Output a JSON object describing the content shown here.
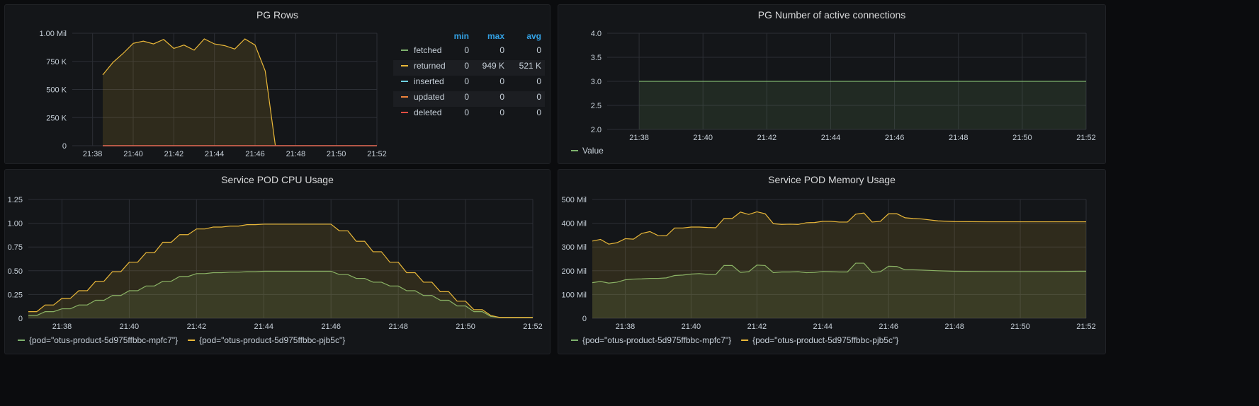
{
  "panels": [
    {
      "id": "pg-rows",
      "title": "PG Rows",
      "legend": {
        "headers": [
          "min",
          "max",
          "avg"
        ],
        "rows": [
          {
            "name": "fetched",
            "color": "#7eb26d",
            "min": "0",
            "max": "0",
            "avg": "0"
          },
          {
            "name": "returned",
            "color": "#eab839",
            "min": "0",
            "max": "949 K",
            "avg": "521 K"
          },
          {
            "name": "inserted",
            "color": "#6ed0e0",
            "min": "0",
            "max": "0",
            "avg": "0"
          },
          {
            "name": "updated",
            "color": "#ef843c",
            "min": "0",
            "max": "0",
            "avg": "0"
          },
          {
            "name": "deleted",
            "color": "#e24d42",
            "min": "0",
            "max": "0",
            "avg": "0"
          }
        ]
      }
    },
    {
      "id": "pg-connections",
      "title": "PG Number of active connections",
      "legend_items": [
        {
          "name": "Value",
          "color": "#7eb26d"
        }
      ]
    },
    {
      "id": "pod-cpu",
      "title": "Service POD CPU Usage",
      "legend_items": [
        {
          "name": "{pod=\"otus-product-5d975ffbbc-mpfc7\"}",
          "color": "#7eb26d"
        },
        {
          "name": "{pod=\"otus-product-5d975ffbbc-pjb5c\"}",
          "color": "#eab839"
        }
      ]
    },
    {
      "id": "pod-memory",
      "title": "Service POD Memory Usage",
      "legend_items": [
        {
          "name": "{pod=\"otus-product-5d975ffbbc-mpfc7\"}",
          "color": "#7eb26d"
        },
        {
          "name": "{pod=\"otus-product-5d975ffbbc-pjb5c\"}",
          "color": "#eab839"
        }
      ]
    }
  ],
  "chart_data": [
    {
      "type": "area",
      "title": "PG Rows",
      "x_range": [
        "21:37",
        "21:52"
      ],
      "x_ticks": [
        "21:38",
        "21:40",
        "21:42",
        "21:44",
        "21:46",
        "21:48",
        "21:50",
        "21:52"
      ],
      "y_ticks": [
        "0",
        "250 K",
        "500 K",
        "750 K",
        "1.00 Mil"
      ],
      "ylim": [
        0,
        1000000
      ],
      "series": [
        {
          "name": "returned",
          "color": "#eab839",
          "x": [
            "21:38:30",
            "21:39:00",
            "21:39:30",
            "21:40:00",
            "21:40:30",
            "21:41:00",
            "21:41:30",
            "21:42:00",
            "21:42:30",
            "21:43:00",
            "21:43:30",
            "21:44:00",
            "21:44:30",
            "21:45:00",
            "21:45:30",
            "21:46:00",
            "21:46:30",
            "21:47:00"
          ],
          "values": [
            630000,
            740000,
            820000,
            910000,
            930000,
            905000,
            945000,
            865000,
            895000,
            850000,
            950000,
            905000,
            890000,
            860000,
            950000,
            895000,
            665000,
            0
          ]
        },
        {
          "name": "fetched",
          "color": "#7eb26d",
          "x": [
            "21:38:30",
            "21:52:00"
          ],
          "values": [
            0,
            0
          ]
        },
        {
          "name": "inserted",
          "color": "#6ed0e0",
          "x": [
            "21:38:30",
            "21:52:00"
          ],
          "values": [
            0,
            0
          ]
        },
        {
          "name": "updated",
          "color": "#ef843c",
          "x": [
            "21:38:30",
            "21:52:00"
          ],
          "values": [
            0,
            0
          ]
        },
        {
          "name": "deleted",
          "color": "#e24d42",
          "x": [
            "21:38:30",
            "21:52:00"
          ],
          "values": [
            0,
            0
          ]
        }
      ]
    },
    {
      "type": "area",
      "title": "PG Number of active connections",
      "x_range": [
        "21:37",
        "21:52"
      ],
      "x_ticks": [
        "21:38",
        "21:40",
        "21:42",
        "21:44",
        "21:46",
        "21:48",
        "21:50",
        "21:52"
      ],
      "y_ticks": [
        "2.0",
        "2.5",
        "3.0",
        "3.5",
        "4.0"
      ],
      "ylim": [
        2,
        4
      ],
      "series": [
        {
          "name": "Value",
          "color": "#7eb26d",
          "x": [
            "21:38:00",
            "21:52:00"
          ],
          "values": [
            3,
            3
          ]
        }
      ]
    },
    {
      "type": "area",
      "title": "Service POD CPU Usage",
      "x_range": [
        "21:37",
        "21:52"
      ],
      "x_ticks": [
        "21:38",
        "21:40",
        "21:42",
        "21:44",
        "21:46",
        "21:48",
        "21:50",
        "21:52"
      ],
      "y_ticks": [
        "0",
        "0.25",
        "0.50",
        "0.75",
        "1.00",
        "1.25"
      ],
      "ylim": [
        0,
        1.25
      ],
      "series": [
        {
          "name": "{pod=\"otus-product-5d975ffbbc-mpfc7\"}",
          "color": "#7eb26d",
          "x": [
            "21:37:00",
            "21:37:15",
            "21:37:30",
            "21:37:45",
            "21:38:00",
            "21:38:15",
            "21:38:30",
            "21:38:45",
            "21:39:00",
            "21:39:15",
            "21:39:30",
            "21:39:45",
            "21:40:00",
            "21:40:15",
            "21:40:30",
            "21:40:45",
            "21:41:00",
            "21:41:15",
            "21:41:30",
            "21:41:45",
            "21:42:00",
            "21:42:15",
            "21:42:30",
            "21:42:45",
            "21:43:00",
            "21:43:15",
            "21:43:30",
            "21:43:45",
            "21:44:00",
            "21:45:00",
            "21:46:00",
            "21:46:15",
            "21:46:30",
            "21:46:45",
            "21:47:00",
            "21:47:15",
            "21:47:30",
            "21:47:45",
            "21:48:00",
            "21:48:15",
            "21:48:30",
            "21:48:45",
            "21:49:00",
            "21:49:15",
            "21:49:30",
            "21:49:45",
            "21:50:00",
            "21:50:15",
            "21:50:30",
            "21:50:45",
            "21:51:00",
            "21:51:30",
            "21:52:00"
          ],
          "values": [
            0.03,
            0.03,
            0.07,
            0.07,
            0.1,
            0.1,
            0.14,
            0.14,
            0.19,
            0.19,
            0.24,
            0.24,
            0.29,
            0.29,
            0.34,
            0.34,
            0.39,
            0.39,
            0.44,
            0.44,
            0.47,
            0.47,
            0.48,
            0.48,
            0.485,
            0.485,
            0.49,
            0.49,
            0.495,
            0.495,
            0.495,
            0.46,
            0.46,
            0.42,
            0.42,
            0.38,
            0.38,
            0.34,
            0.34,
            0.29,
            0.29,
            0.24,
            0.24,
            0.19,
            0.19,
            0.13,
            0.13,
            0.07,
            0.07,
            0.02,
            0.01,
            0.01,
            0.01
          ]
        },
        {
          "name": "{pod=\"otus-product-5d975ffbbc-pjb5c\"}",
          "color": "#eab839",
          "x": [
            "21:37:00",
            "21:37:15",
            "21:37:30",
            "21:37:45",
            "21:38:00",
            "21:38:15",
            "21:38:30",
            "21:38:45",
            "21:39:00",
            "21:39:15",
            "21:39:30",
            "21:39:45",
            "21:40:00",
            "21:40:15",
            "21:40:30",
            "21:40:45",
            "21:41:00",
            "21:41:15",
            "21:41:30",
            "21:41:45",
            "21:42:00",
            "21:42:15",
            "21:42:30",
            "21:42:45",
            "21:43:00",
            "21:43:15",
            "21:43:30",
            "21:43:45",
            "21:44:00",
            "21:45:00",
            "21:46:00",
            "21:46:15",
            "21:46:30",
            "21:46:45",
            "21:47:00",
            "21:47:15",
            "21:47:30",
            "21:47:45",
            "21:48:00",
            "21:48:15",
            "21:48:30",
            "21:48:45",
            "21:49:00",
            "21:49:15",
            "21:49:30",
            "21:49:45",
            "21:50:00",
            "21:50:15",
            "21:50:30",
            "21:50:45",
            "21:51:00",
            "21:51:30",
            "21:52:00"
          ],
          "values": [
            0.07,
            0.07,
            0.14,
            0.14,
            0.21,
            0.21,
            0.29,
            0.29,
            0.39,
            0.39,
            0.49,
            0.49,
            0.59,
            0.59,
            0.69,
            0.69,
            0.8,
            0.8,
            0.88,
            0.88,
            0.94,
            0.94,
            0.96,
            0.96,
            0.97,
            0.97,
            0.985,
            0.985,
            0.99,
            0.99,
            0.99,
            0.92,
            0.92,
            0.81,
            0.81,
            0.7,
            0.7,
            0.59,
            0.59,
            0.48,
            0.48,
            0.38,
            0.38,
            0.28,
            0.28,
            0.18,
            0.18,
            0.09,
            0.09,
            0.03,
            0.01,
            0.01,
            0.01
          ]
        }
      ]
    },
    {
      "type": "area",
      "title": "Service POD Memory Usage",
      "x_range": [
        "21:37",
        "21:52"
      ],
      "x_ticks": [
        "21:38",
        "21:40",
        "21:42",
        "21:44",
        "21:46",
        "21:48",
        "21:50",
        "21:52"
      ],
      "y_ticks": [
        "0",
        "100 Mil",
        "200 Mil",
        "300 Mil",
        "400 Mil",
        "500 Mil"
      ],
      "ylim": [
        0,
        500000000
      ],
      "series": [
        {
          "name": "{pod=\"otus-product-5d975ffbbc-mpfc7\"}",
          "color": "#7eb26d",
          "x": [
            "21:37:00",
            "21:37:15",
            "21:37:30",
            "21:37:45",
            "21:38:00",
            "21:38:15",
            "21:38:30",
            "21:38:45",
            "21:39:00",
            "21:39:15",
            "21:39:30",
            "21:39:45",
            "21:40:00",
            "21:40:15",
            "21:40:30",
            "21:40:45",
            "21:41:00",
            "21:41:15",
            "21:41:30",
            "21:41:45",
            "21:42:00",
            "21:42:15",
            "21:42:30",
            "21:42:45",
            "21:43:00",
            "21:43:15",
            "21:43:30",
            "21:43:45",
            "21:44:00",
            "21:44:15",
            "21:44:30",
            "21:44:45",
            "21:45:00",
            "21:45:15",
            "21:45:30",
            "21:45:45",
            "21:46:00",
            "21:46:15",
            "21:46:30",
            "21:46:45",
            "21:47:00",
            "21:47:30",
            "21:48:00",
            "21:49:00",
            "21:50:00",
            "21:51:00",
            "21:52:00"
          ],
          "values": [
            150000000,
            155000000,
            148000000,
            152000000,
            162000000,
            165000000,
            166000000,
            168000000,
            168000000,
            170000000,
            180000000,
            182000000,
            186000000,
            188000000,
            185000000,
            184000000,
            222000000,
            222000000,
            193000000,
            196000000,
            224000000,
            222000000,
            192000000,
            195000000,
            195000000,
            196000000,
            192000000,
            193000000,
            197000000,
            196000000,
            195000000,
            195000000,
            232000000,
            232000000,
            193000000,
            196000000,
            219000000,
            218000000,
            204000000,
            204000000,
            203000000,
            200000000,
            198000000,
            197000000,
            197000000,
            197000000,
            198000000
          ]
        },
        {
          "name": "{pod=\"otus-product-5d975ffbbc-pjb5c\"}",
          "color": "#eab839",
          "x": [
            "21:37:00",
            "21:37:15",
            "21:37:30",
            "21:37:45",
            "21:38:00",
            "21:38:15",
            "21:38:30",
            "21:38:45",
            "21:39:00",
            "21:39:15",
            "21:39:30",
            "21:39:45",
            "21:40:00",
            "21:40:15",
            "21:40:30",
            "21:40:45",
            "21:41:00",
            "21:41:15",
            "21:41:30",
            "21:41:45",
            "21:42:00",
            "21:42:15",
            "21:42:30",
            "21:42:45",
            "21:43:00",
            "21:43:15",
            "21:43:30",
            "21:43:45",
            "21:44:00",
            "21:44:15",
            "21:44:30",
            "21:44:45",
            "21:45:00",
            "21:45:15",
            "21:45:30",
            "21:45:45",
            "21:46:00",
            "21:46:15",
            "21:46:30",
            "21:46:45",
            "21:47:00",
            "21:47:30",
            "21:48:00",
            "21:49:00",
            "21:50:00",
            "21:51:00",
            "21:52:00"
          ],
          "values": [
            325000000,
            332000000,
            312000000,
            318000000,
            335000000,
            333000000,
            357000000,
            365000000,
            348000000,
            347000000,
            380000000,
            380000000,
            384000000,
            384000000,
            382000000,
            381000000,
            420000000,
            420000000,
            447000000,
            437000000,
            448000000,
            440000000,
            398000000,
            395000000,
            396000000,
            395000000,
            402000000,
            403000000,
            408000000,
            408000000,
            405000000,
            405000000,
            438000000,
            443000000,
            405000000,
            408000000,
            440000000,
            440000000,
            423000000,
            420000000,
            418000000,
            410000000,
            407000000,
            406000000,
            406000000,
            406000000,
            406000000
          ]
        }
      ]
    }
  ]
}
